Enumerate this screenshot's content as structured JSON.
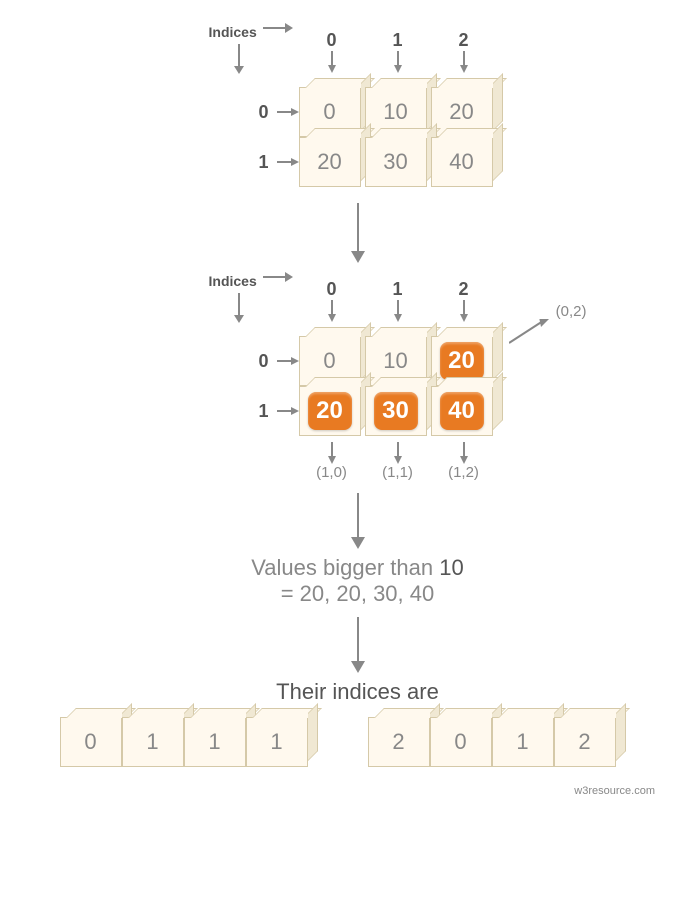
{
  "labels": {
    "indices": "Indices",
    "col_idx": [
      "0",
      "1",
      "2"
    ],
    "row_idx": [
      "0",
      "1"
    ]
  },
  "array1": {
    "rows": [
      [
        "0",
        "10",
        "20"
      ],
      [
        "20",
        "30",
        "40"
      ]
    ]
  },
  "array2": {
    "rows": [
      [
        "0",
        "10",
        "20"
      ],
      [
        "20",
        "30",
        "40"
      ]
    ],
    "highlighted": [
      [
        0,
        2
      ],
      [
        1,
        0
      ],
      [
        1,
        1
      ],
      [
        1,
        2
      ]
    ],
    "coords": {
      "top_right": "(0,2)",
      "bottom": [
        "(1,0)",
        "(1,1)",
        "(1,2)"
      ]
    }
  },
  "text": {
    "bigger_line1": "Values bigger than",
    "bigger_value": "10",
    "bigger_line2": "= 20, 20, 30, 40",
    "indices_are": "Their indices are"
  },
  "result": {
    "left": [
      "0",
      "1",
      "1",
      "1"
    ],
    "right": [
      "2",
      "0",
      "1",
      "2"
    ]
  },
  "footer": "w3resource.com"
}
